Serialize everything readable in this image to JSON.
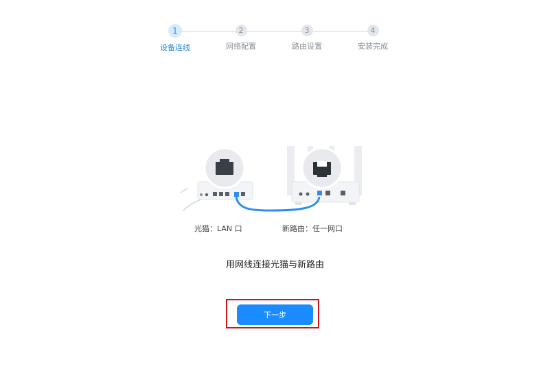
{
  "stepper": {
    "steps": [
      {
        "number": "1",
        "label": "设备连线",
        "active": true
      },
      {
        "number": "2",
        "label": "网络配置",
        "active": false
      },
      {
        "number": "3",
        "label": "路由设置",
        "active": false
      },
      {
        "number": "4",
        "label": "安装完成",
        "active": false
      }
    ]
  },
  "illustration": {
    "modem_caption": "光猫：LAN 口",
    "router_caption": "新路由：任一网口",
    "cable_color": "#2e8ef0"
  },
  "main": {
    "instruction": "用网线连接光猫与新路由",
    "next_label": "下一步"
  },
  "colors": {
    "accent": "#1a8cff",
    "highlight_border": "#c8161d"
  }
}
